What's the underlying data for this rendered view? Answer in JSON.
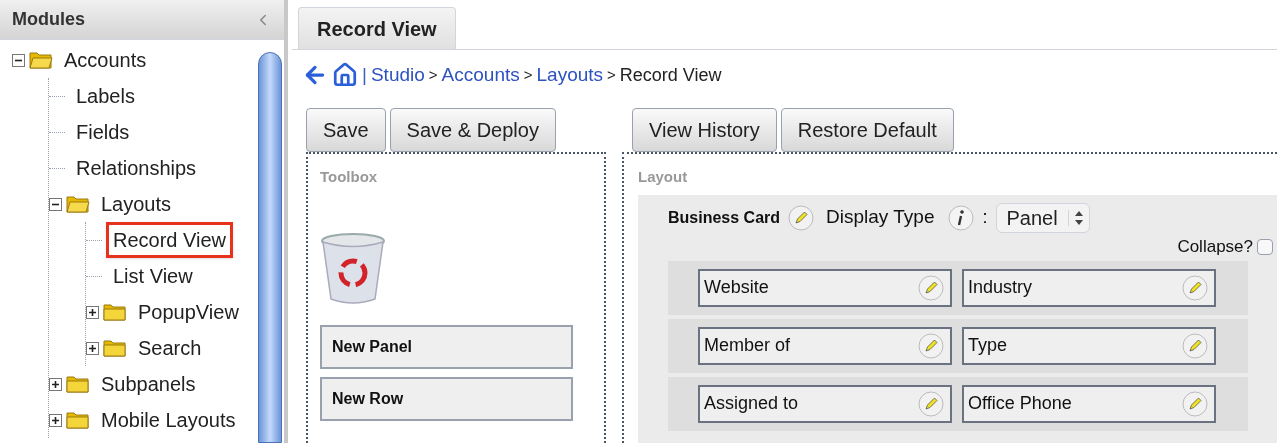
{
  "sidebar": {
    "title": "Modules",
    "tree": [
      {
        "label": "Accounts",
        "kind": "folder",
        "expanded": true,
        "selected": false,
        "children": [
          {
            "label": "Labels",
            "kind": "item",
            "selected": false
          },
          {
            "label": "Fields",
            "kind": "item",
            "selected": false
          },
          {
            "label": "Relationships",
            "kind": "item",
            "selected": false
          },
          {
            "label": "Layouts",
            "kind": "folder",
            "expanded": true,
            "selected": false,
            "children": [
              {
                "label": "Record View",
                "kind": "item",
                "selected": true
              },
              {
                "label": "List View",
                "kind": "item",
                "selected": false
              },
              {
                "label": "PopupView",
                "kind": "folder",
                "expanded": false,
                "selected": false
              },
              {
                "label": "Search",
                "kind": "folder",
                "expanded": false,
                "selected": false
              }
            ]
          },
          {
            "label": "Subpanels",
            "kind": "folder",
            "expanded": false,
            "selected": false
          },
          {
            "label": "Mobile Layouts",
            "kind": "folder",
            "expanded": false,
            "selected": false
          }
        ]
      }
    ]
  },
  "tab": {
    "label": "Record View",
    "selected": true
  },
  "breadcrumb": {
    "lead": "|",
    "separator": ">",
    "links": [
      "Studio",
      "Accounts",
      "Layouts"
    ],
    "current": "Record View"
  },
  "left_buttons": [
    "Save",
    "Save & Deploy"
  ],
  "right_buttons": [
    "View History",
    "Restore Default"
  ],
  "toolbox": {
    "title": "Toolbox",
    "items": [
      "New Panel",
      "New Row"
    ]
  },
  "layout": {
    "title": "Layout",
    "panel": {
      "title": "Business Card",
      "display_type_label": "Display Type",
      "colon": ":",
      "display_type": "Panel",
      "collapse_label": "Collapse?",
      "collapse_checked": false,
      "rows": [
        {
          "fields": [
            "Website",
            "Industry"
          ]
        },
        {
          "fields": [
            "Member of",
            "Type"
          ]
        },
        {
          "fields": [
            "Assigned to",
            "Office Phone"
          ]
        }
      ]
    }
  }
}
